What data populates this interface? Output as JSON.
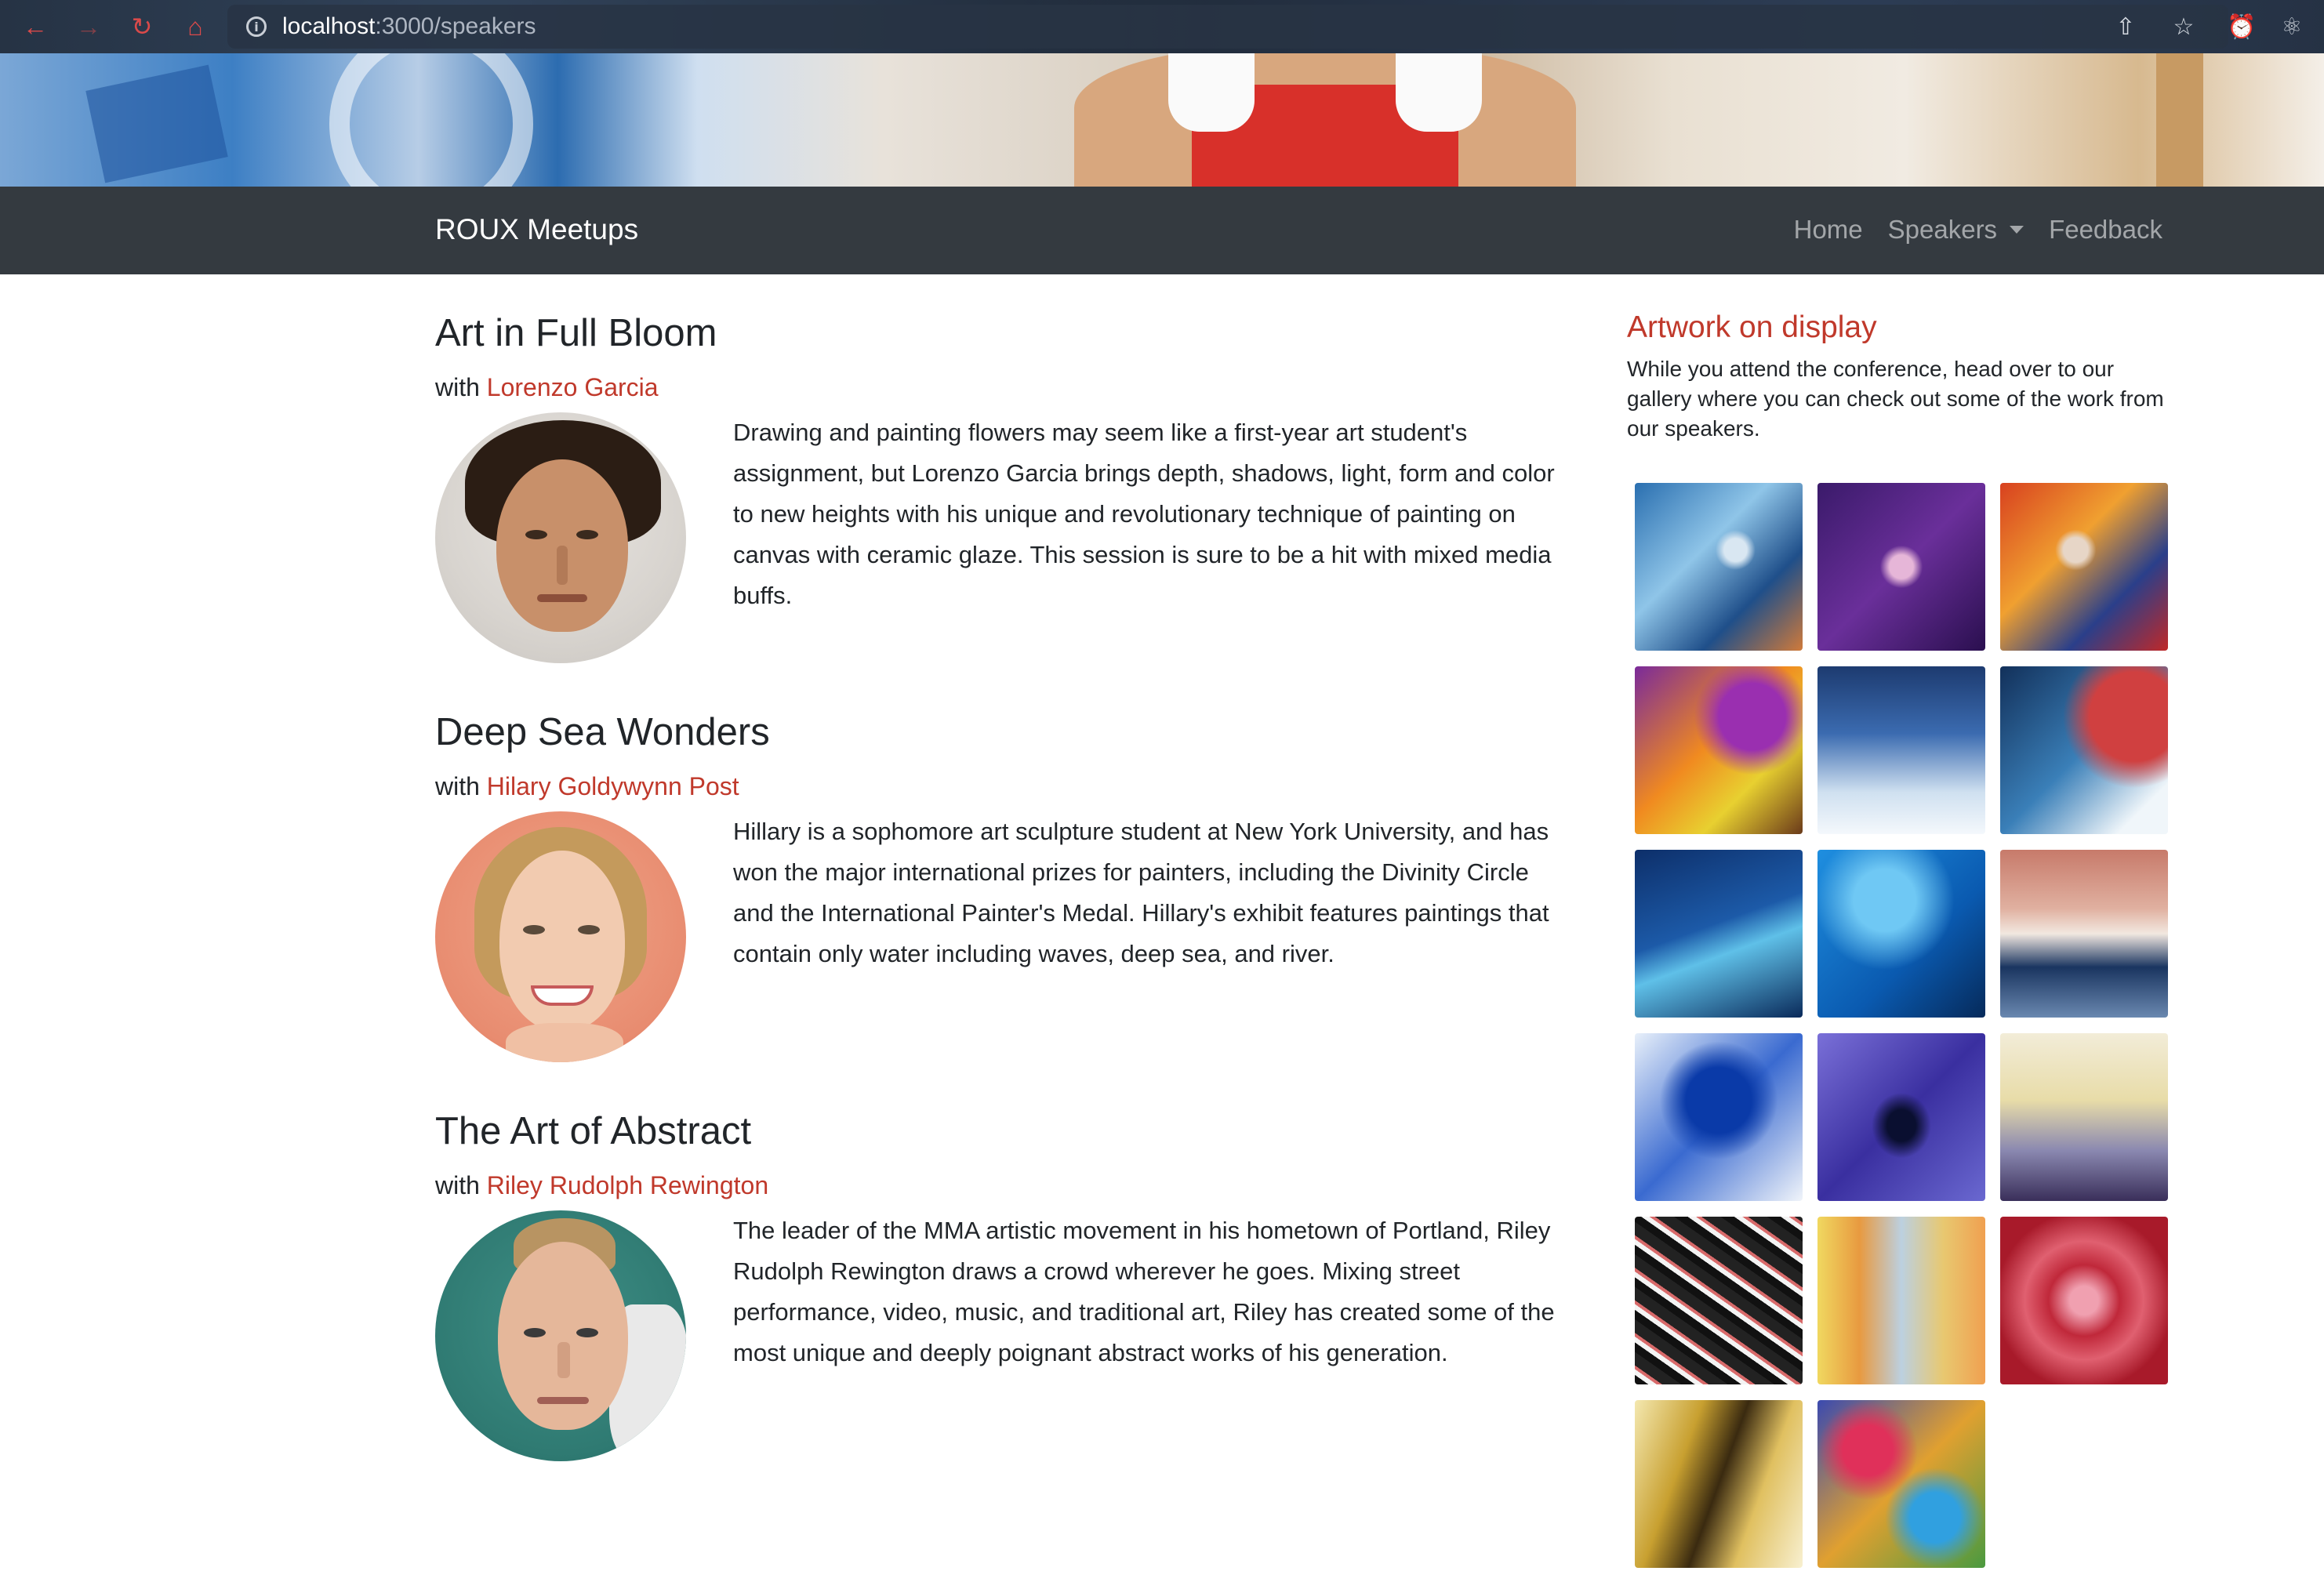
{
  "browser": {
    "url_host": "localhost",
    "url_path": ":3000/speakers"
  },
  "navbar": {
    "brand": "ROUX Meetups",
    "links": [
      {
        "label": "Home"
      },
      {
        "label": "Speakers",
        "dropdown": true
      },
      {
        "label": "Feedback"
      }
    ]
  },
  "sessions": [
    {
      "title": "Art in Full Bloom",
      "with": "with",
      "speaker": "Lorenzo Garcia",
      "description": "Drawing and painting flowers may seem like a first-year art student's assignment, but Lorenzo Garcia brings depth, shadows, light, form and color to new heights with his unique and revolutionary technique of painting on canvas with ceramic glaze. This session is sure to be a hit with mixed media buffs."
    },
    {
      "title": "Deep Sea Wonders",
      "with": "with",
      "speaker": "Hilary Goldywynn Post",
      "description": "Hillary is a sophomore art sculpture student at New York University, and has won the major international prizes for painters, including the Divinity Circle and the International Painter's Medal. Hillary's exhibit features paintings that contain only water including waves, deep sea, and river."
    },
    {
      "title": "The Art of Abstract",
      "with": "with",
      "speaker": "Riley Rudolph Rewington",
      "description": "The leader of the MMA artistic movement in his hometown of Portland, Riley Rudolph Rewington draws a crowd wherever he goes. Mixing street performance, video, music, and traditional art, Riley has created some of the most unique and deeply poignant abstract works of his generation."
    }
  ],
  "sidebar": {
    "title": "Artwork on display",
    "text": "While you attend the conference, head over to our gallery where you can check out some of the work from our speakers."
  },
  "colors": {
    "accent": "#c0392b",
    "navbar": "#343a40"
  }
}
